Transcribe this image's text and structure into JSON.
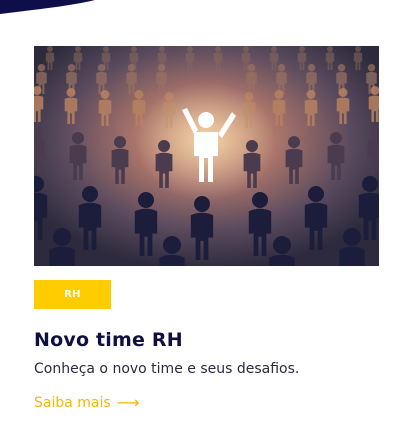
{
  "card": {
    "tag_label": "RH",
    "title": "Novo time RH",
    "description": "Conheça o novo time e seus desafios.",
    "link_label": "Saiba mais",
    "link_arrow": "⟶"
  },
  "colors": {
    "tag_bg": "#ffcc00",
    "title": "#101040",
    "link": "#f2b705",
    "swoosh": "#0e0e4a"
  },
  "icons": {
    "hero": "crowd-of-figures-image",
    "link": "arrow-right-icon"
  }
}
